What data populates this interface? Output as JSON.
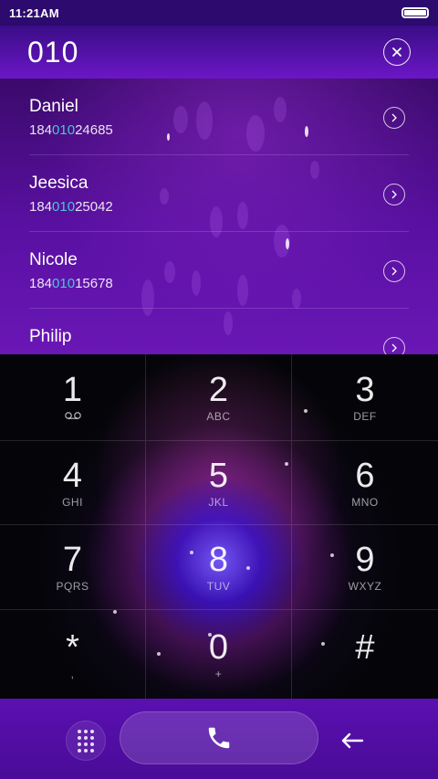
{
  "status_bar": {
    "time": "11:21AM"
  },
  "header": {
    "dialed": "010"
  },
  "contacts": [
    {
      "name": "Daniel",
      "num_prefix": "184",
      "num_match": "010",
      "num_suffix": "24685"
    },
    {
      "name": "Jeesica",
      "num_prefix": "184",
      "num_match": "010",
      "num_suffix": "25042"
    },
    {
      "name": "Nicole",
      "num_prefix": "184",
      "num_match": "010",
      "num_suffix": "15678"
    },
    {
      "name": "Philip"
    }
  ],
  "keypad": [
    {
      "digit": "1",
      "letters": "",
      "extra": "voicemail-icon"
    },
    {
      "digit": "2",
      "letters": "ABC"
    },
    {
      "digit": "3",
      "letters": "DEF"
    },
    {
      "digit": "4",
      "letters": "GHI"
    },
    {
      "digit": "5",
      "letters": "JKL"
    },
    {
      "digit": "6",
      "letters": "MNO"
    },
    {
      "digit": "7",
      "letters": "PQRS"
    },
    {
      "digit": "8",
      "letters": "TUV"
    },
    {
      "digit": "9",
      "letters": "WXYZ"
    },
    {
      "digit": "*",
      "letters": ","
    },
    {
      "digit": "0",
      "letters": "+"
    },
    {
      "digit": "#",
      "letters": ""
    }
  ],
  "icons": {
    "clear": "close-icon",
    "chevron": "chevron-right-icon",
    "voicemail": "voicemail-icon",
    "dialpad": "dialpad-icon",
    "call": "phone-icon",
    "backspace": "arrow-left-icon"
  },
  "colors": {
    "accent": "#6b16c6",
    "match_highlight": "#47c7d6",
    "bottom_bar": "#5a10b0"
  }
}
